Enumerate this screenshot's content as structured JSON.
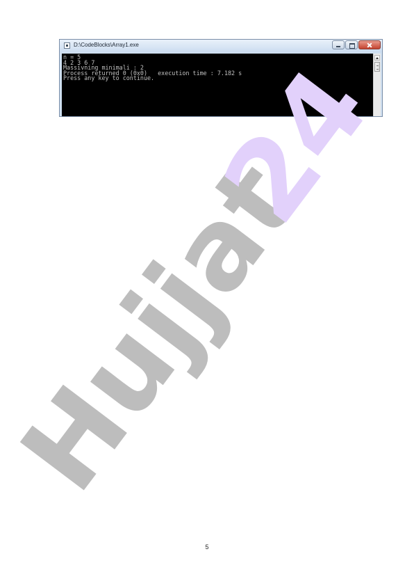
{
  "window": {
    "title": "D:\\CodeBlocks\\Array1.exe",
    "console_lines": [
      "n = 5",
      "4 2 3 6 7",
      "Massivning minimali : 2",
      "Process returned 0 (0x0)   execution time : 7.182 s",
      "Press any key to continue."
    ]
  },
  "watermark": {
    "text": "Hujjat 24",
    "colors": [
      "#bdbdbd",
      "#e2d1fb"
    ]
  },
  "page": {
    "number": "5"
  }
}
